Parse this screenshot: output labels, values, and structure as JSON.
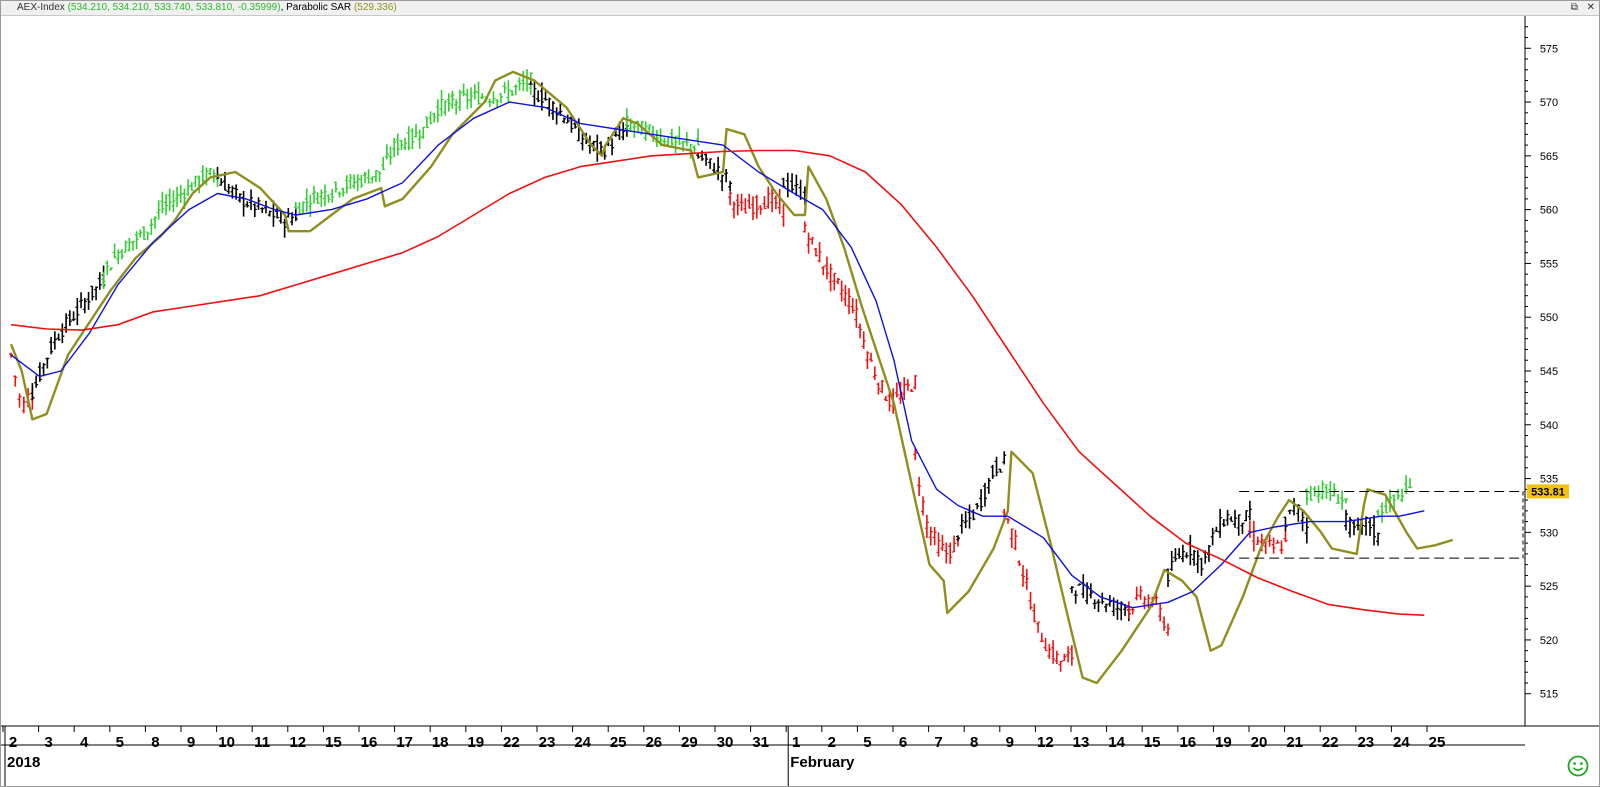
{
  "window": {
    "title_instrument": "AEX-Index",
    "title_values": "(534.210, 534.210, 533.740, 533.810, -0.35999)",
    "title_indicator": "Parabolic SAR",
    "title_indicator_value": "(529.336)",
    "button_restore": "⧉",
    "button_close": "✕"
  },
  "colors": {
    "up": "#33cc33",
    "down": "#ee1111",
    "neutral": "#000000",
    "sar": "#8f8f1f",
    "ma_fast": "#1010e0",
    "ma_slow": "#ee1111",
    "price_tag": "#f4c20d"
  },
  "icons": {
    "status": "smiley-icon"
  },
  "chart_data": {
    "type": "candlestick",
    "title": "AEX-Index",
    "ylim": [
      512,
      578
    ],
    "yticks": [
      515,
      520,
      525,
      530,
      535,
      540,
      545,
      550,
      555,
      560,
      565,
      570,
      575
    ],
    "last_price": "533.81",
    "x_day_labels": [
      "2",
      "3",
      "4",
      "5",
      "8",
      "9",
      "10",
      "11",
      "12",
      "15",
      "16",
      "17",
      "18",
      "19",
      "22",
      "23",
      "24",
      "25",
      "26",
      "29",
      "30",
      "31",
      "1",
      "2",
      "5",
      "6",
      "7",
      "8",
      "9",
      "12",
      "13",
      "14",
      "15",
      "16",
      "19",
      "20",
      "21",
      "22",
      "23",
      "24",
      "25"
    ],
    "x_major_labels": [
      {
        "label": "2018",
        "at_day": "2"
      },
      {
        "label": "February",
        "at_day": "1"
      }
    ],
    "price_segments": [
      {
        "trend": "down",
        "start_day": 0.0,
        "end_day": 0.6,
        "values": [
          546.5,
          544,
          541.5,
          542.5,
          543
        ]
      },
      {
        "trend": "neutral",
        "start_day": 0.6,
        "end_day": 2.6,
        "values": [
          543,
          545,
          547,
          548.5,
          549.5,
          550.5,
          551.5,
          552.5,
          553.5
        ]
      },
      {
        "trend": "up",
        "start_day": 2.6,
        "end_day": 5.8,
        "values": [
          554,
          556,
          557,
          558,
          560,
          561,
          562,
          563,
          563.5
        ]
      },
      {
        "trend": "neutral",
        "start_day": 5.8,
        "end_day": 8.0,
        "values": [
          563,
          562,
          561,
          560.5,
          560,
          559.5,
          559,
          559.5
        ]
      },
      {
        "trend": "up",
        "start_day": 8.0,
        "end_day": 12.4,
        "values": [
          560,
          561,
          561.5,
          562,
          562.5,
          563,
          563.5,
          566,
          566.5,
          567.5,
          569.5,
          570
        ]
      },
      {
        "trend": "up",
        "start_day": 12.4,
        "end_day": 14.6,
        "values": [
          570,
          570.5,
          570.5,
          571,
          572
        ]
      },
      {
        "trend": "neutral",
        "start_day": 14.6,
        "end_day": 17.3,
        "values": [
          571,
          570.5,
          569.5,
          568.5,
          567,
          566,
          565.5,
          566.5,
          567.5
        ]
      },
      {
        "trend": "up",
        "start_day": 17.3,
        "end_day": 19.3,
        "values": [
          568,
          567.5,
          567,
          566.5,
          566,
          566
        ]
      },
      {
        "trend": "neutral",
        "start_day": 19.3,
        "end_day": 20.2,
        "values": [
          565,
          564,
          562.5
        ]
      },
      {
        "trend": "down",
        "start_day": 20.2,
        "end_day": 21.7,
        "values": [
          561,
          560,
          560.5,
          561,
          560
        ]
      },
      {
        "trend": "neutral",
        "start_day": 21.7,
        "end_day": 22.3,
        "values": [
          562.5,
          561.5
        ]
      },
      {
        "trend": "down",
        "start_day": 22.3,
        "end_day": 25.4,
        "values": [
          558,
          556,
          554,
          552.5,
          551,
          547,
          544,
          542,
          543,
          544
        ]
      },
      {
        "trend": "down",
        "start_day": 25.4,
        "end_day": 26.6,
        "values": [
          537,
          531,
          529,
          528,
          529
        ]
      },
      {
        "trend": "neutral",
        "start_day": 26.6,
        "end_day": 27.9,
        "values": [
          530,
          531,
          532,
          534,
          536,
          536.5
        ]
      },
      {
        "trend": "down",
        "start_day": 27.9,
        "end_day": 29.8,
        "values": [
          532,
          529,
          525,
          521,
          519,
          518,
          518.5
        ]
      },
      {
        "trend": "neutral",
        "start_day": 29.8,
        "end_day": 31.4,
        "values": [
          525,
          524.5,
          524,
          523.5,
          523,
          523
        ]
      },
      {
        "trend": "down",
        "start_day": 31.4,
        "end_day": 32.5,
        "values": [
          523,
          524,
          523.5,
          521
        ]
      },
      {
        "trend": "neutral",
        "start_day": 32.5,
        "end_day": 34.8,
        "values": [
          526,
          528,
          528.5,
          527,
          530,
          531.5,
          531,
          531.5
        ]
      },
      {
        "trend": "down",
        "start_day": 34.8,
        "end_day": 35.8,
        "values": [
          530,
          529,
          528.5,
          529
        ]
      },
      {
        "trend": "neutral",
        "start_day": 35.8,
        "end_day": 36.4,
        "values": [
          531,
          532.5,
          530.5
        ]
      },
      {
        "trend": "up",
        "start_day": 36.4,
        "end_day": 37.5,
        "values": [
          533.5,
          534,
          533.5,
          533
        ]
      },
      {
        "trend": "neutral",
        "start_day": 37.5,
        "end_day": 38.4,
        "values": [
          531,
          530,
          531,
          529.5
        ]
      },
      {
        "trend": "up",
        "start_day": 38.4,
        "end_day": 39.3,
        "values": [
          532,
          532.5,
          533.5,
          534
        ]
      }
    ],
    "series": [
      {
        "key": "sar",
        "values": [
          [
            0.0,
            547.5
          ],
          [
            0.3,
            545
          ],
          [
            0.6,
            540.5
          ],
          [
            1.0,
            541
          ],
          [
            1.6,
            546.5
          ],
          [
            2.2,
            549.5
          ],
          [
            2.8,
            552.5
          ],
          [
            3.5,
            555.5
          ],
          [
            4.2,
            557.5
          ],
          [
            4.6,
            559
          ],
          [
            5.1,
            561.5
          ],
          [
            5.6,
            563
          ],
          [
            6.3,
            563.5
          ],
          [
            7.0,
            562
          ],
          [
            7.7,
            559.5
          ],
          [
            7.8,
            558
          ],
          [
            8.4,
            558
          ],
          [
            9.0,
            559.5
          ],
          [
            9.6,
            561
          ],
          [
            10.4,
            562
          ],
          [
            10.5,
            560.3
          ],
          [
            11.0,
            561
          ],
          [
            11.8,
            564
          ],
          [
            12.4,
            567
          ],
          [
            13.3,
            570
          ],
          [
            13.6,
            572
          ],
          [
            14.1,
            572.8
          ],
          [
            14.7,
            572
          ],
          [
            15.6,
            569.5
          ],
          [
            16.3,
            566
          ],
          [
            16.6,
            565
          ],
          [
            16.7,
            566
          ],
          [
            17.2,
            568.5
          ],
          [
            17.6,
            568
          ],
          [
            18.3,
            566
          ],
          [
            19.1,
            565.5
          ],
          [
            19.3,
            563
          ],
          [
            20.0,
            563.5
          ],
          [
            20.1,
            567.5
          ],
          [
            20.6,
            567
          ],
          [
            21.0,
            564
          ],
          [
            21.5,
            561.5
          ],
          [
            22.0,
            559.5
          ],
          [
            22.3,
            559.5
          ],
          [
            22.4,
            564
          ],
          [
            22.9,
            561
          ],
          [
            23.4,
            556.5
          ],
          [
            23.9,
            551
          ],
          [
            24.4,
            546
          ],
          [
            24.8,
            542
          ],
          [
            25.0,
            539
          ],
          [
            25.4,
            533
          ],
          [
            25.8,
            527
          ],
          [
            26.2,
            525.5
          ],
          [
            26.3,
            522.5
          ],
          [
            26.9,
            524.5
          ],
          [
            27.6,
            528.5
          ],
          [
            28.0,
            532
          ],
          [
            28.1,
            537.5
          ],
          [
            28.7,
            535.5
          ],
          [
            29.2,
            529
          ],
          [
            29.7,
            522
          ],
          [
            30.1,
            516.5
          ],
          [
            30.5,
            516
          ],
          [
            31.2,
            519
          ],
          [
            32.0,
            523
          ],
          [
            32.4,
            526.5
          ],
          [
            32.9,
            525.5
          ],
          [
            33.3,
            524
          ],
          [
            33.7,
            519
          ],
          [
            34.0,
            519.5
          ],
          [
            34.6,
            524
          ],
          [
            35.1,
            528.5
          ],
          [
            35.6,
            531.5
          ],
          [
            35.9,
            533
          ],
          [
            36.3,
            532
          ],
          [
            36.8,
            530
          ],
          [
            37.1,
            528.5
          ],
          [
            37.8,
            528
          ],
          [
            38.0,
            532.5
          ],
          [
            38.1,
            534
          ],
          [
            38.6,
            533.5
          ],
          [
            39.2,
            530
          ],
          [
            39.5,
            528.5
          ],
          [
            40.0,
            528.8
          ],
          [
            40.5,
            529.3
          ]
        ]
      },
      {
        "key": "ma_fast",
        "values": [
          [
            0.0,
            546.5
          ],
          [
            0.8,
            544.5
          ],
          [
            1.4,
            545
          ],
          [
            2.2,
            548.5
          ],
          [
            3.0,
            553
          ],
          [
            4.0,
            557
          ],
          [
            5.0,
            560
          ],
          [
            5.8,
            561.5
          ],
          [
            6.6,
            561
          ],
          [
            7.4,
            560
          ],
          [
            8.0,
            559.5
          ],
          [
            9.0,
            560
          ],
          [
            10.0,
            561
          ],
          [
            11.0,
            562.5
          ],
          [
            12.0,
            566
          ],
          [
            13.0,
            568.5
          ],
          [
            14.0,
            570
          ],
          [
            15.0,
            569.5
          ],
          [
            16.0,
            568
          ],
          [
            17.0,
            567.5
          ],
          [
            18.0,
            567
          ],
          [
            19.0,
            566.5
          ],
          [
            20.0,
            566
          ],
          [
            21.0,
            563.5
          ],
          [
            22.0,
            561.5
          ],
          [
            22.8,
            560
          ],
          [
            23.6,
            556.5
          ],
          [
            24.3,
            551.5
          ],
          [
            24.8,
            546
          ],
          [
            25.3,
            538.5
          ],
          [
            26.0,
            534
          ],
          [
            26.6,
            532.5
          ],
          [
            27.3,
            531.5
          ],
          [
            28.0,
            531.5
          ],
          [
            29.0,
            529.5
          ],
          [
            29.8,
            526
          ],
          [
            30.6,
            524
          ],
          [
            31.5,
            523
          ],
          [
            32.5,
            523.5
          ],
          [
            33.2,
            524.5
          ],
          [
            34.0,
            527
          ],
          [
            34.8,
            530
          ],
          [
            35.5,
            530.5
          ],
          [
            36.5,
            531
          ],
          [
            37.5,
            531
          ],
          [
            38.5,
            531.5
          ],
          [
            39.0,
            531.5
          ],
          [
            39.7,
            532
          ]
        ]
      },
      {
        "key": "ma_slow",
        "values": [
          [
            0.0,
            549.3
          ],
          [
            1.0,
            548.9
          ],
          [
            2.0,
            548.8
          ],
          [
            3.0,
            549.3
          ],
          [
            4.0,
            550.5
          ],
          [
            5.0,
            551
          ],
          [
            6.0,
            551.5
          ],
          [
            7.0,
            552
          ],
          [
            8.0,
            553
          ],
          [
            9.0,
            554
          ],
          [
            10.0,
            555
          ],
          [
            11.0,
            556
          ],
          [
            12.0,
            557.5
          ],
          [
            13.0,
            559.5
          ],
          [
            14.0,
            561.5
          ],
          [
            15.0,
            563
          ],
          [
            16.0,
            564
          ],
          [
            17.0,
            564.5
          ],
          [
            18.0,
            565
          ],
          [
            19.0,
            565.2
          ],
          [
            20.0,
            565.4
          ],
          [
            21.0,
            565.5
          ],
          [
            22.0,
            565.5
          ],
          [
            23.0,
            565
          ],
          [
            24.0,
            563.5
          ],
          [
            25.0,
            560.5
          ],
          [
            26.0,
            556.5
          ],
          [
            27.0,
            552
          ],
          [
            28.0,
            547
          ],
          [
            29.0,
            542
          ],
          [
            30.0,
            537.5
          ],
          [
            31.0,
            534.5
          ],
          [
            32.0,
            531.5
          ],
          [
            33.0,
            529
          ],
          [
            34.0,
            527.5
          ],
          [
            35.0,
            525.8
          ],
          [
            36.0,
            524.5
          ],
          [
            37.0,
            523.3
          ],
          [
            38.0,
            522.8
          ],
          [
            39.0,
            522.4
          ],
          [
            39.7,
            522.3
          ]
        ]
      }
    ],
    "ref_lines": [
      {
        "y": 533.8,
        "from_day": 34.5,
        "to_day": 42.8
      },
      {
        "y": 527.6,
        "from_day": 34.5,
        "to_day": 42.8
      }
    ]
  }
}
